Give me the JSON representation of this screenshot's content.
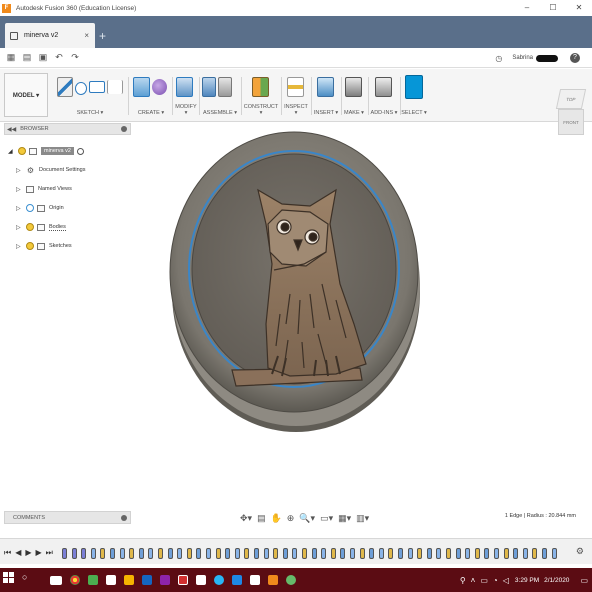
{
  "window": {
    "title": "Autodesk Fusion 360 (Education License)",
    "logo_letter": "F",
    "controls": [
      "–",
      "☐",
      "✕"
    ]
  },
  "tabs": [
    {
      "label": "minerva v2",
      "close": "×"
    }
  ],
  "new_tab_label": "+",
  "quickbar": {
    "job_status_icon": "clock-icon",
    "user_name": "Sabrina",
    "help": "?"
  },
  "ribbon": {
    "workspace": "MODEL ▾",
    "groups": [
      {
        "label": "SKETCH ▾"
      },
      {
        "label": "CREATE ▾"
      },
      {
        "label": "MODIFY ▾"
      },
      {
        "label": "ASSEMBLE ▾"
      },
      {
        "label": "CONSTRUCT ▾"
      },
      {
        "label": "INSPECT ▾"
      },
      {
        "label": "INSERT ▾"
      },
      {
        "label": "MAKE ▾"
      },
      {
        "label": "ADD-INS ▾"
      },
      {
        "label": "SELECT ▾"
      }
    ]
  },
  "browser": {
    "header": "BROWSER",
    "root": "minerva v2",
    "items": [
      {
        "label": "Document Settings",
        "icon": "gear-icon"
      },
      {
        "label": "Named Views",
        "icon": "folder-icon"
      },
      {
        "label": "Origin",
        "icon": "folder-icon"
      },
      {
        "label": "Bodies",
        "icon": "folder-icon"
      },
      {
        "label": "Sketches",
        "icon": "folder-icon"
      }
    ]
  },
  "viewcube": {
    "top": "TOP",
    "front": "FRONT"
  },
  "comments": {
    "label": "COMMENTS"
  },
  "status": {
    "selection": "1 Edge | Radius : 20.844 mm"
  },
  "taskbar": {
    "time": "3:29 PM",
    "date": "2/1/2020"
  },
  "colors": {
    "accent": "#0696d7",
    "tabbar": "#5a6f8a",
    "taskbar": "#5b0c13",
    "coin_rim": "#85827a",
    "coin_face": "#6d6860",
    "owl": "#8b735c"
  }
}
